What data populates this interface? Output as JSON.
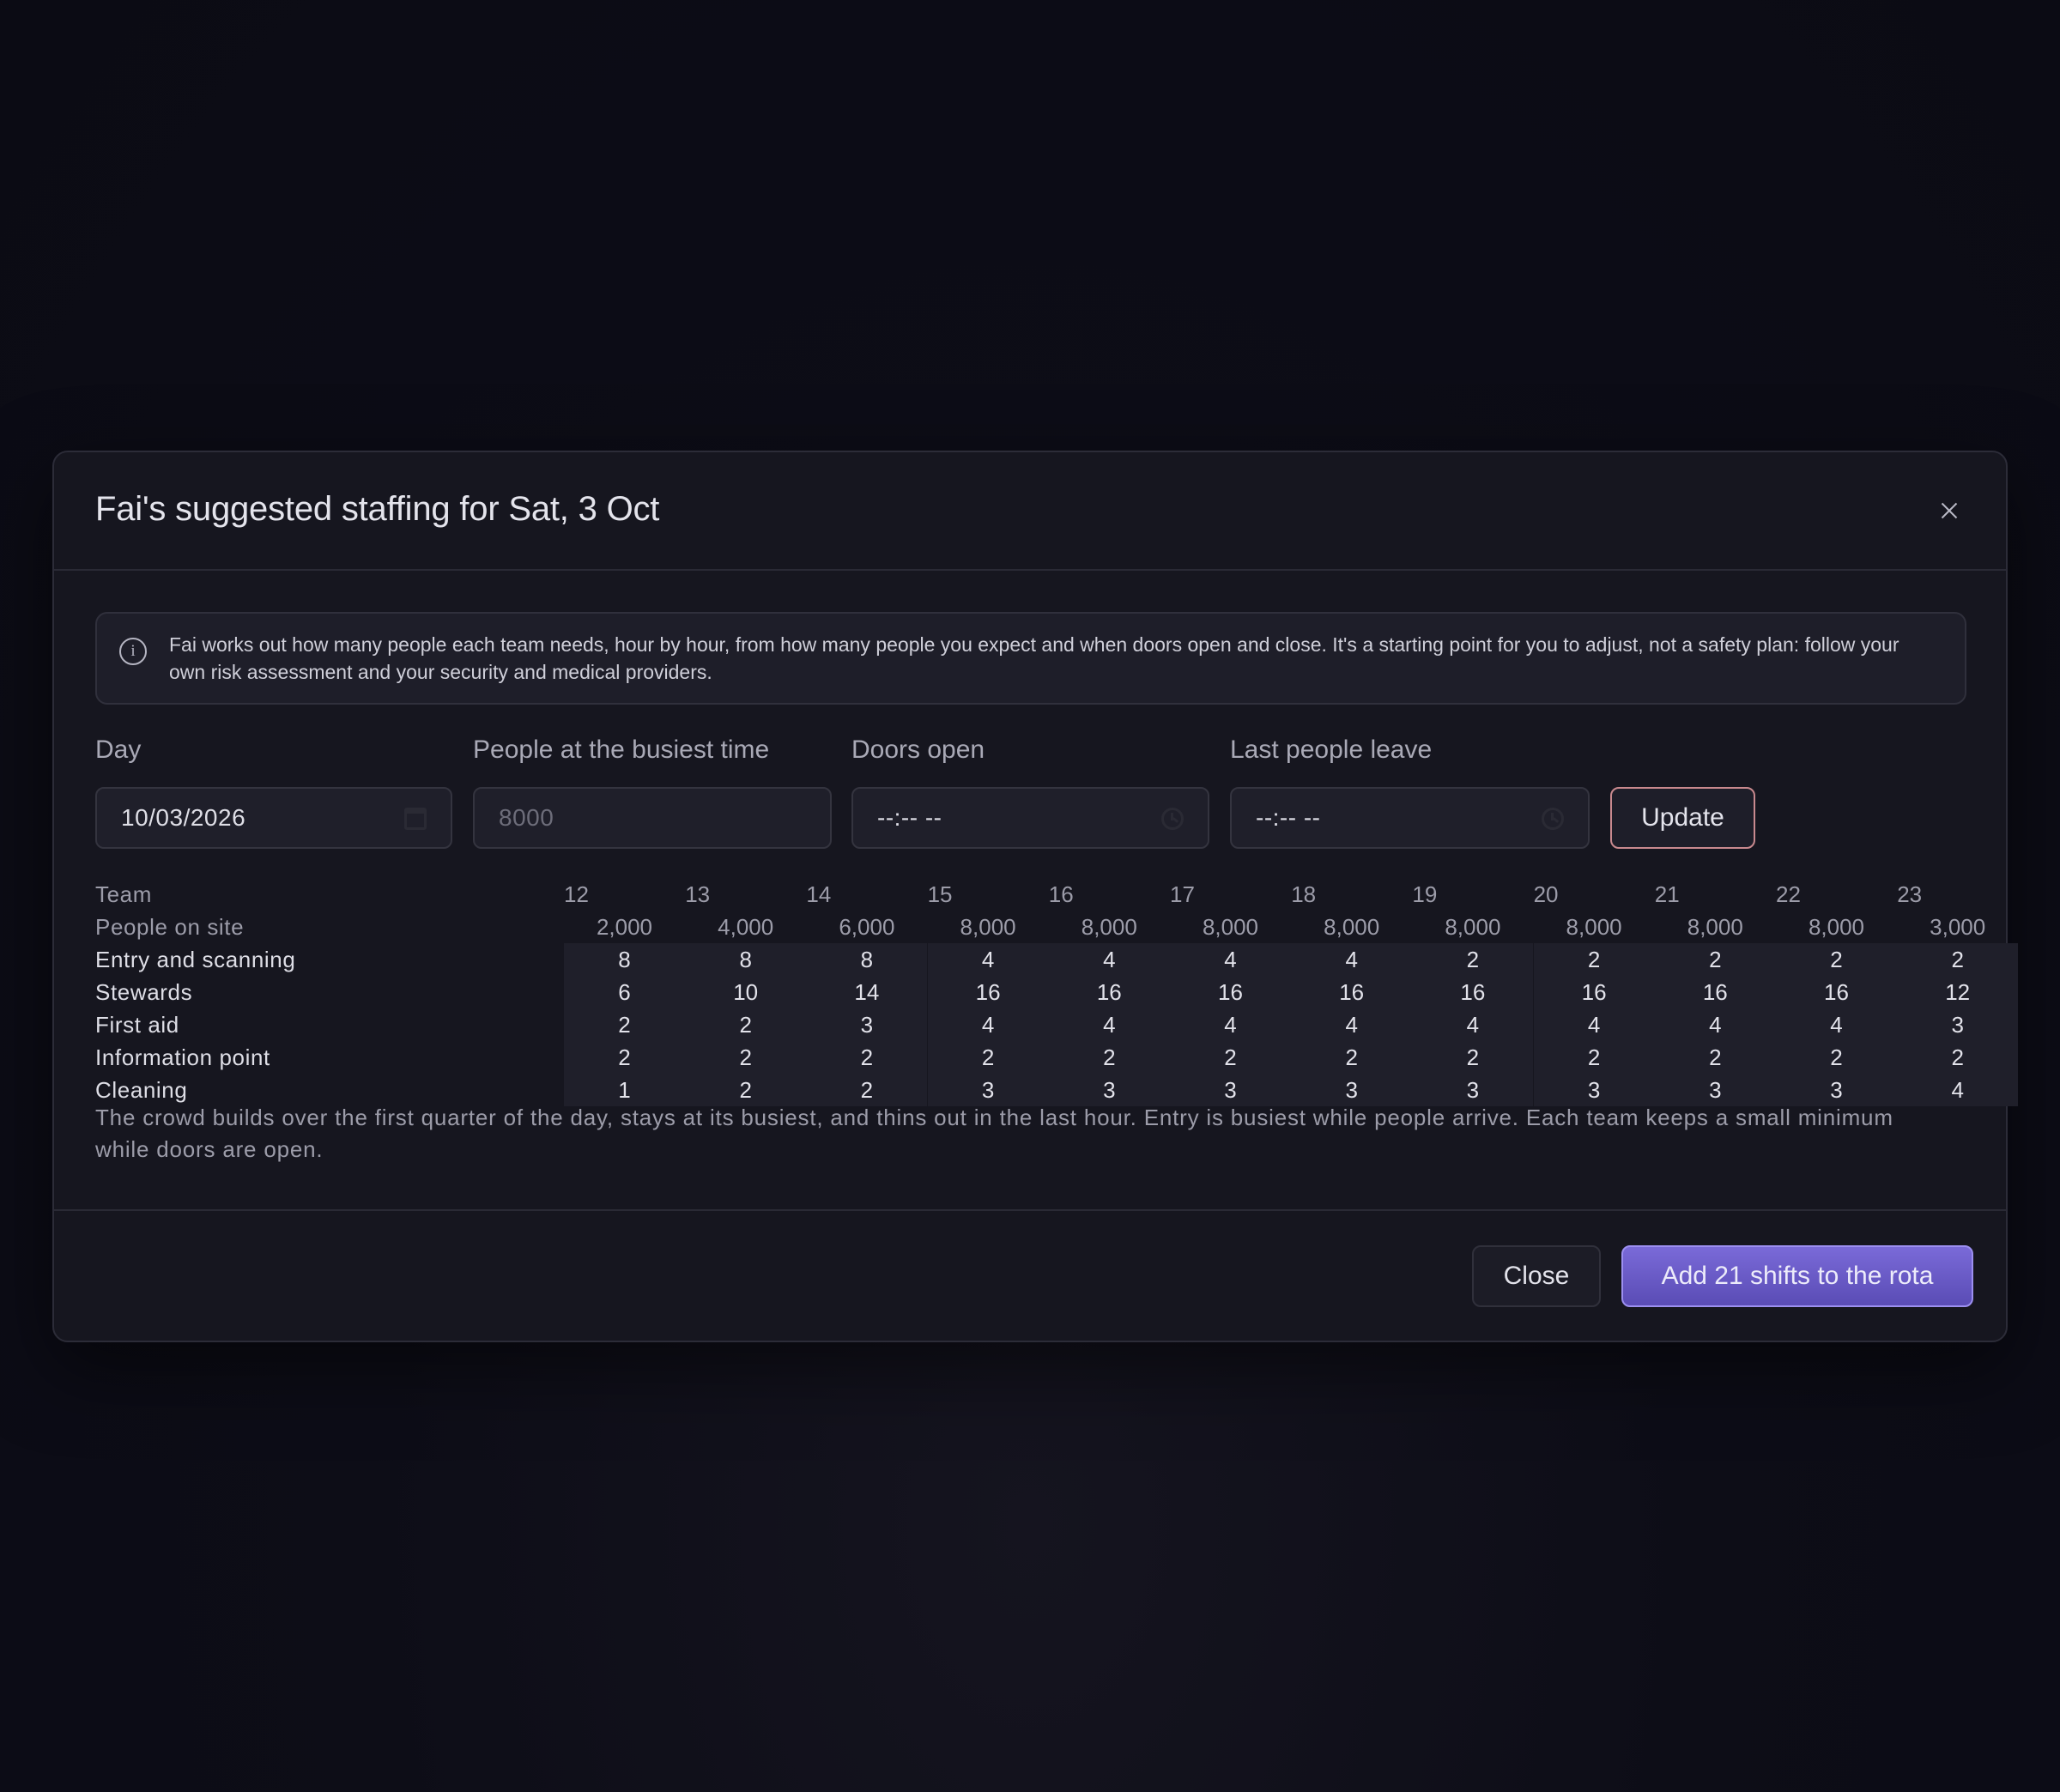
{
  "modal": {
    "title": "Fai's suggested staffing for Sat, 3 Oct",
    "close_icon": "close-icon"
  },
  "info": {
    "icon": "info-icon",
    "text": "Fai works out how many people each team needs, hour by hour, from how many people you expect and when doors open and close. It's a starting point for you to adjust, not a safety plan: follow your own risk assessment and your security and medical providers."
  },
  "form": {
    "day_label": "Day",
    "day_value": "10/03/2026",
    "busiest_label": "People at the busiest time",
    "busiest_placeholder": "8000",
    "doors_open_label": "Doors open",
    "doors_open_value": "--:-- --",
    "last_leave_label": "Last people leave",
    "last_leave_value": "--:-- --",
    "update_label": "Update"
  },
  "grid": {
    "team_header": "Team",
    "hours": [
      "12",
      "13",
      "14",
      "15",
      "16",
      "17",
      "18",
      "19",
      "20",
      "21",
      "22",
      "23"
    ],
    "people_label": "People on site",
    "people": [
      "2,000",
      "4,000",
      "6,000",
      "8,000",
      "8,000",
      "8,000",
      "8,000",
      "8,000",
      "8,000",
      "8,000",
      "8,000",
      "3,000"
    ],
    "teams": [
      {
        "name": "Entry and scanning",
        "values": [
          "8",
          "8",
          "8",
          "4",
          "4",
          "4",
          "4",
          "2",
          "2",
          "2",
          "2",
          "2"
        ]
      },
      {
        "name": "Stewards",
        "values": [
          "6",
          "10",
          "14",
          "16",
          "16",
          "16",
          "16",
          "16",
          "16",
          "16",
          "16",
          "12"
        ]
      },
      {
        "name": "First aid",
        "values": [
          "2",
          "2",
          "3",
          "4",
          "4",
          "4",
          "4",
          "4",
          "4",
          "4",
          "4",
          "3"
        ]
      },
      {
        "name": "Information point",
        "values": [
          "2",
          "2",
          "2",
          "2",
          "2",
          "2",
          "2",
          "2",
          "2",
          "2",
          "2",
          "2"
        ]
      },
      {
        "name": "Cleaning",
        "values": [
          "1",
          "2",
          "2",
          "3",
          "3",
          "3",
          "3",
          "3",
          "3",
          "3",
          "3",
          "4"
        ]
      }
    ],
    "summary": "The crowd builds over the first quarter of the day, stays at its busiest, and thins out in the last hour. Entry is busiest while people arrive. Each team keeps a small minimum while doors are open."
  },
  "footer": {
    "close_label": "Close",
    "add_label": "Add 21 shifts to the rota"
  }
}
